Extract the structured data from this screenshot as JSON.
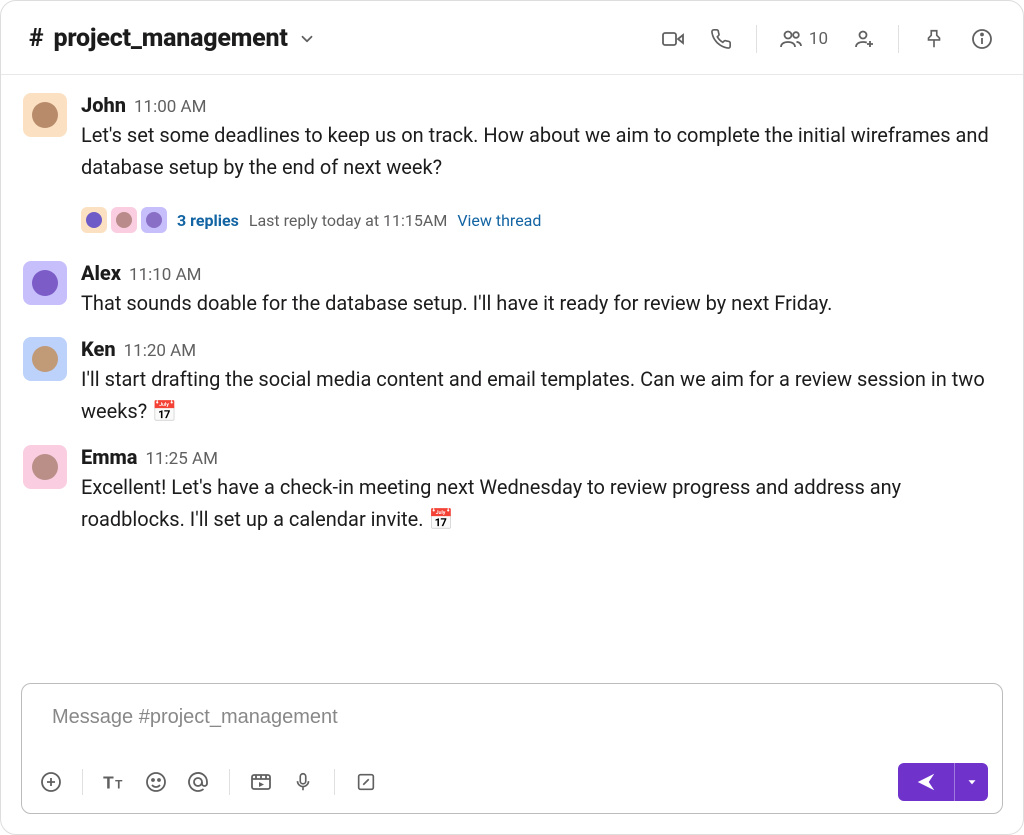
{
  "header": {
    "channel_prefix": "#",
    "channel_name": "project_management",
    "member_count": "10"
  },
  "messages": [
    {
      "author": "John",
      "time": "11:00 AM",
      "avatar_color": "peach",
      "text": "Let's set some deadlines to keep us on track. How about we aim to complete the initial wireframes and database setup by the end of next week?",
      "thread": {
        "replies_label": "3 replies",
        "last_reply_label": "Last reply today at 11:15AM",
        "view_label": "View thread",
        "participants": [
          "peach",
          "pink",
          "purple"
        ]
      }
    },
    {
      "author": "Alex",
      "time": "11:10 AM",
      "avatar_color": "purple",
      "text": "That sounds doable for the database setup. I'll have it ready for review by next Friday."
    },
    {
      "author": "Ken",
      "time": "11:20 AM",
      "avatar_color": "blue",
      "text": "I'll start drafting the social media content and email templates. Can we aim for a review session in two weeks? 📅"
    },
    {
      "author": "Emma",
      "time": "11:25 AM",
      "avatar_color": "pink",
      "text": "Excellent! Let's have a check-in meeting next Wednesday to review progress and address any roadblocks. I'll set up a calendar invite. 📅"
    }
  ],
  "composer": {
    "placeholder": "Message #project_management"
  }
}
